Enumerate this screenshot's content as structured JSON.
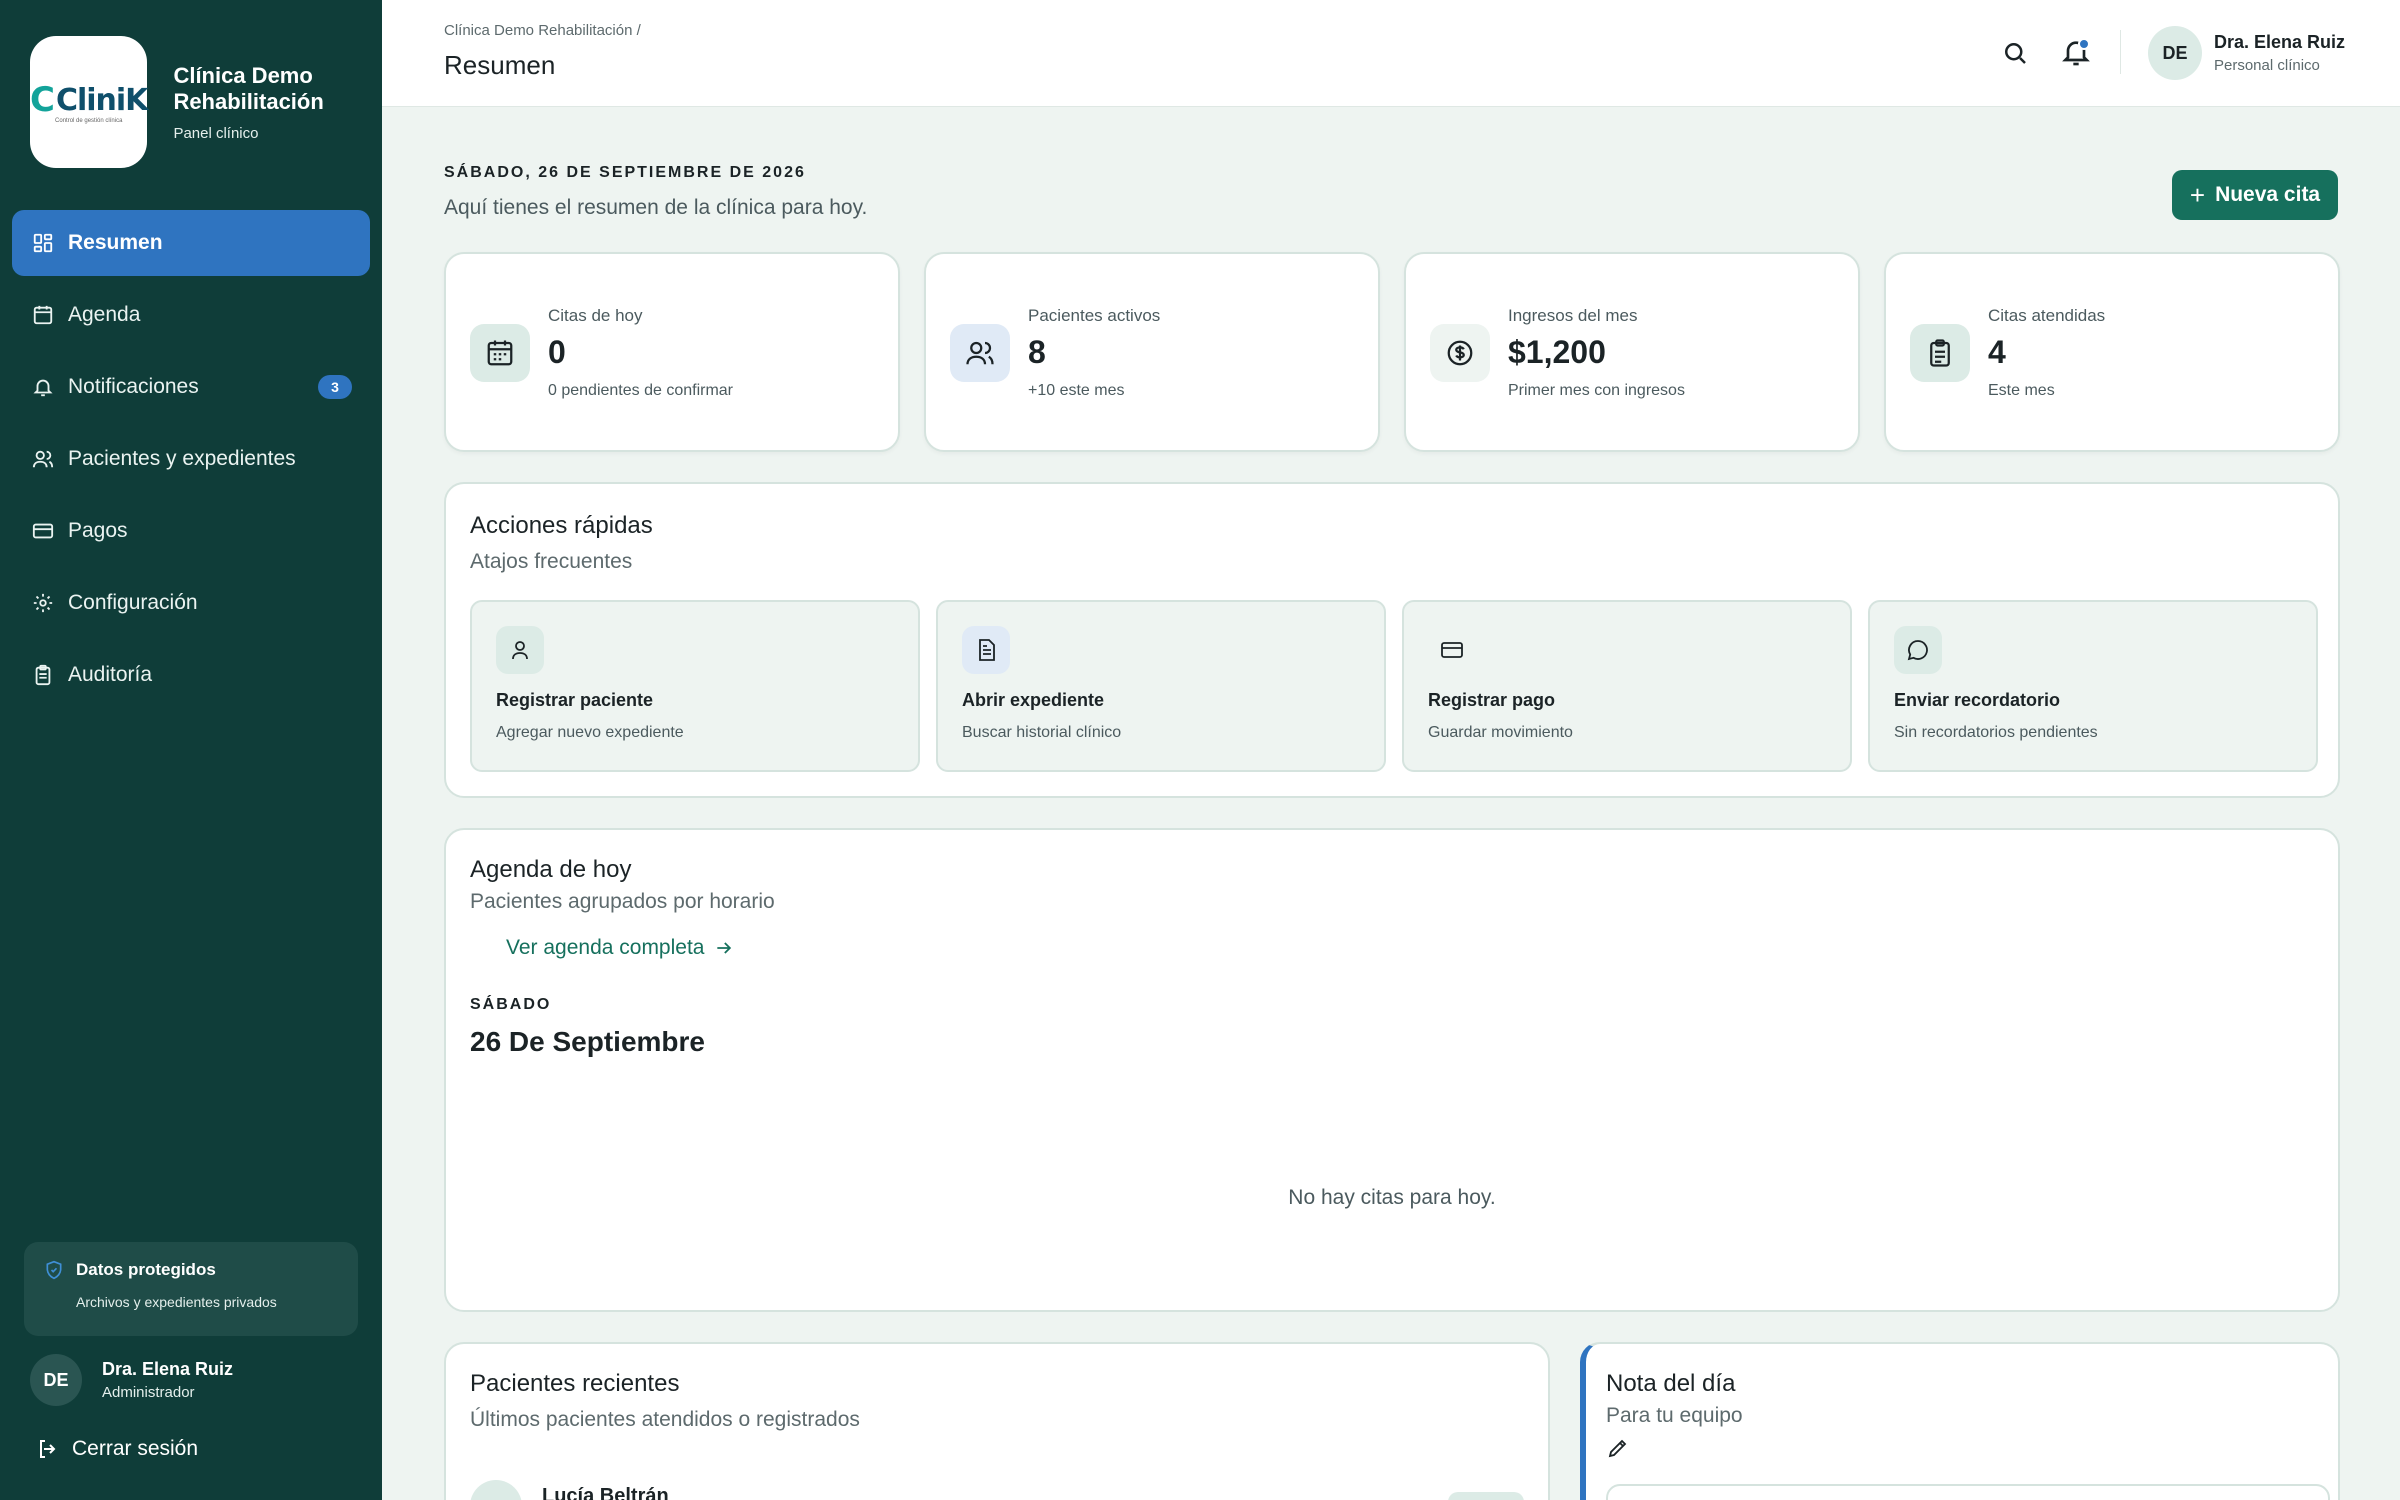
{
  "colors": {
    "sidebar": "#0f3d39",
    "accent_blue": "#2f74c0",
    "accent_green": "#16705d",
    "page_bg": "#eef4f1"
  },
  "brand": {
    "logo_text": "CliniK",
    "logo_tagline": "Control de gestión clínica",
    "name": "Clínica Demo Rehabilitación",
    "subtitle": "Panel clínico"
  },
  "sidebar": {
    "items": [
      {
        "label": "Resumen",
        "icon": "grid-icon",
        "active": true
      },
      {
        "label": "Agenda",
        "icon": "calendar-icon"
      },
      {
        "label": "Notificaciones",
        "icon": "bell-icon",
        "badge": "3"
      },
      {
        "label": "Pacientes y expedientes",
        "icon": "users-icon"
      },
      {
        "label": "Pagos",
        "icon": "card-icon"
      },
      {
        "label": "Configuración",
        "icon": "gear-icon"
      },
      {
        "label": "Auditoría",
        "icon": "clipboard-icon"
      }
    ],
    "protected": {
      "title": "Datos protegidos",
      "subtitle": "Archivos y expedientes privados"
    },
    "user": {
      "initials": "DE",
      "name": "Dra. Elena Ruiz",
      "role": "Administrador"
    },
    "logout_label": "Cerrar sesión"
  },
  "header": {
    "breadcrumb": "Clínica Demo Rehabilitación /",
    "title": "Resumen",
    "user": {
      "initials": "DE",
      "name": "Dra. Elena Ruiz",
      "role": "Personal clínico"
    }
  },
  "main": {
    "date": "SÁBADO, 26 DE SEPTIEMBRE DE 2026",
    "welcome": "Aquí tienes el resumen de la clínica para hoy.",
    "new_button": "Nueva cita",
    "stats": [
      {
        "label": "Citas de hoy",
        "value": "0",
        "sub": "0 pendientes de confirmar",
        "icon": "calendar-icon"
      },
      {
        "label": "Pacientes activos",
        "value": "8",
        "sub": "+10 este mes",
        "icon": "users-icon"
      },
      {
        "label": "Ingresos del mes",
        "value": "$1,200",
        "sub": "Primer mes con ingresos",
        "icon": "dollar-icon"
      },
      {
        "label": "Citas atendidas",
        "value": "4",
        "sub": "Este mes",
        "icon": "clipboard-icon"
      }
    ],
    "quick_actions": {
      "title": "Acciones rápidas",
      "subtitle": "Atajos frecuentes",
      "items": [
        {
          "title": "Registrar paciente",
          "sub": "Agregar nuevo expediente",
          "icon": "user-icon"
        },
        {
          "title": "Abrir expediente",
          "sub": "Buscar historial clínico",
          "icon": "file-icon"
        },
        {
          "title": "Registrar pago",
          "sub": "Guardar movimiento",
          "icon": "card-icon"
        },
        {
          "title": "Enviar recordatorio",
          "sub": "Sin recordatorios pendientes",
          "icon": "chat-icon"
        }
      ]
    },
    "agenda": {
      "title": "Agenda de hoy",
      "subtitle": "Pacientes agrupados por horario",
      "link": "Ver agenda completa",
      "day_label": "SÁBADO",
      "day_date": "26 De Septiembre",
      "empty": "No hay citas para hoy."
    },
    "recent": {
      "title": "Pacientes recientes",
      "subtitle": "Últimos pacientes atendidos o registrados",
      "first_patient": "Lucía Beltrán"
    },
    "note": {
      "title": "Nota del día",
      "subtitle": "Para tu equipo"
    }
  }
}
